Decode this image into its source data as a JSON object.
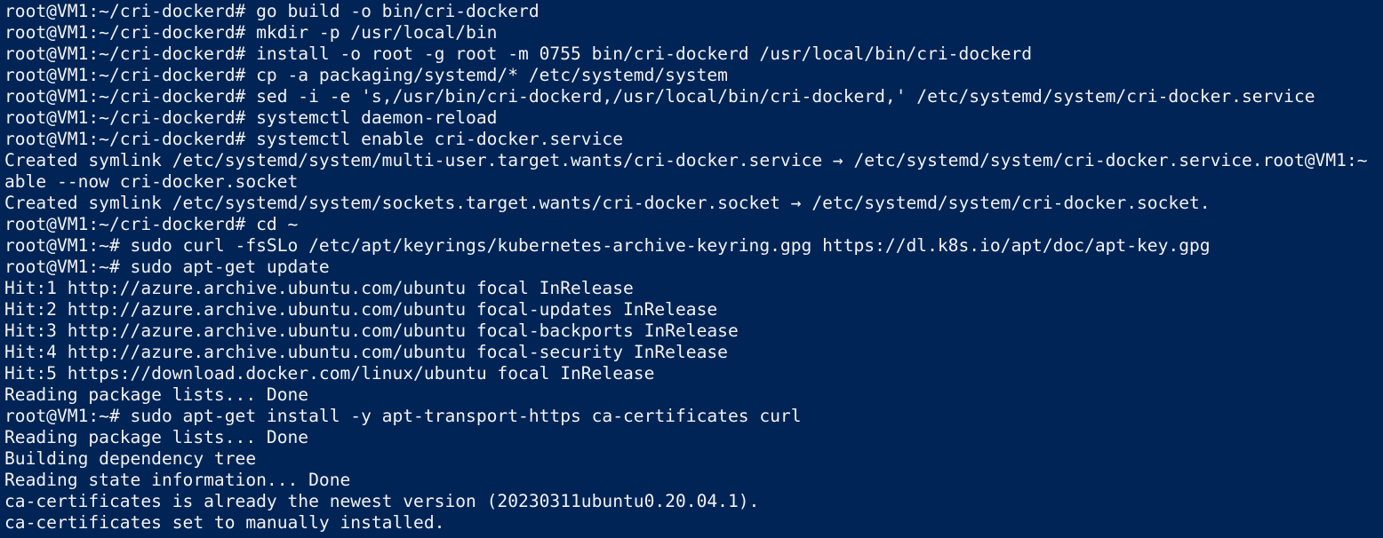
{
  "terminal": {
    "background_color": "#012456",
    "text_color": "#f2f2f2",
    "lines": [
      "root@VM1:~/cri-dockerd# go build -o bin/cri-dockerd",
      "root@VM1:~/cri-dockerd# mkdir -p /usr/local/bin",
      "root@VM1:~/cri-dockerd# install -o root -g root -m 0755 bin/cri-dockerd /usr/local/bin/cri-dockerd",
      "root@VM1:~/cri-dockerd# cp -a packaging/systemd/* /etc/systemd/system",
      "root@VM1:~/cri-dockerd# sed -i -e 's,/usr/bin/cri-dockerd,/usr/local/bin/cri-dockerd,' /etc/systemd/system/cri-docker.service",
      "root@VM1:~/cri-dockerd# systemctl daemon-reload",
      "root@VM1:~/cri-dockerd# systemctl enable cri-docker.service",
      "Created symlink /etc/systemd/system/multi-user.target.wants/cri-docker.service → /etc/systemd/system/cri-docker.service.root@VM1:~",
      "able --now cri-docker.socket",
      "Created symlink /etc/systemd/system/sockets.target.wants/cri-docker.socket → /etc/systemd/system/cri-docker.socket.",
      "root@VM1:~/cri-dockerd# cd ~",
      "root@VM1:~# sudo curl -fsSLo /etc/apt/keyrings/kubernetes-archive-keyring.gpg https://dl.k8s.io/apt/doc/apt-key.gpg",
      "root@VM1:~# sudo apt-get update",
      "Hit:1 http://azure.archive.ubuntu.com/ubuntu focal InRelease",
      "Hit:2 http://azure.archive.ubuntu.com/ubuntu focal-updates InRelease",
      "Hit:3 http://azure.archive.ubuntu.com/ubuntu focal-backports InRelease",
      "Hit:4 http://azure.archive.ubuntu.com/ubuntu focal-security InRelease",
      "Hit:5 https://download.docker.com/linux/ubuntu focal InRelease",
      "Reading package lists... Done",
      "root@VM1:~# sudo apt-get install -y apt-transport-https ca-certificates curl",
      "Reading package lists... Done",
      "Building dependency tree",
      "Reading state information... Done",
      "ca-certificates is already the newest version (20230311ubuntu0.20.04.1).",
      "ca-certificates set to manually installed."
    ]
  }
}
